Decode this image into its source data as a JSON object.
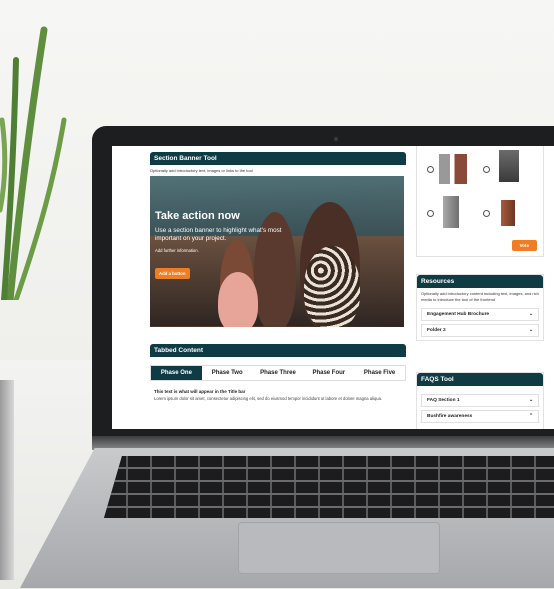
{
  "section_banner": {
    "heading": "Section Banner Tool",
    "intro": "Optionally add introductory text, images or links to the tool",
    "title": "Take action now",
    "text": "Use a section banner to highlight what's most important on your project.",
    "small_text": "Add further information.",
    "button": "Add a button"
  },
  "tabbed": {
    "heading": "Tabbed Content",
    "tabs": [
      "Phase One",
      "Phase Two",
      "Phase Three",
      "Phase Four",
      "Phase Five"
    ],
    "active_tab": 0,
    "content_title": "This text is what will appear in the Title bar",
    "content_body": "Lorem ipsum dolor sit amet, consectetur adipiscing elit, sed do eiusmod tempor incididunt ut labore et dolore magna aliqua."
  },
  "voting": {
    "button": "Vote"
  },
  "resources": {
    "heading": "Resources",
    "intro": "Optionally add introductory content including text, images, and rich media to introduce the tool of the frontend",
    "items": [
      "Engagement Hub Brochure",
      "Folder 2"
    ]
  },
  "faqs": {
    "heading": "FAQS Tool",
    "items": [
      "FAQ Section 1",
      "Bushfire awareness"
    ]
  },
  "colors": {
    "header": "#0e3b44",
    "accent": "#ef7d24"
  }
}
